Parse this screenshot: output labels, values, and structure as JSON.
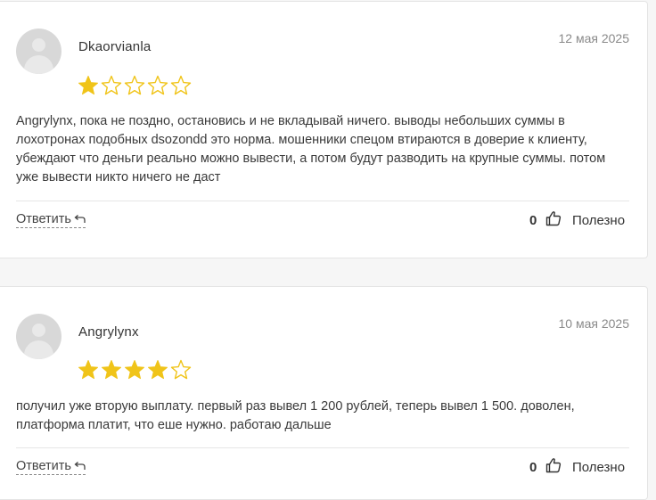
{
  "reviews": [
    {
      "author": "Dkaorvianla",
      "date": "12 мая 2025",
      "rating": 1,
      "max_rating": 5,
      "text": "Angrylynx, пока не поздно, остановись и не вкладывай ничего. выводы небольших суммы в лохотронах подобных dsozondd это норма. мошенники спецом втираются в доверие к клиенту, убеждают что деньги реально можно вывести, а потом будут разводить на крупные суммы. потом уже вывести никто ничего не даст",
      "reply_label": "Ответить",
      "vote_count": "0",
      "helpful_label": "Полезно"
    },
    {
      "author": "Angrylynx",
      "date": "10 мая 2025",
      "rating": 4,
      "max_rating": 5,
      "text": "получил уже вторую выплату. первый раз вывел 1 200 рублей, теперь вывел 1 500. доволен, платформа платит, что еше нужно. работаю дальше",
      "reply_label": "Ответить",
      "vote_count": "0",
      "helpful_label": "Полезно"
    }
  ],
  "colors": {
    "star_filled": "#f0c419",
    "star_empty_stroke": "#f0c419",
    "card_bg": "#ffffff",
    "page_bg": "#f6f6f6"
  },
  "icons": {
    "reply": "reply-arrow-icon",
    "like": "thumbs-up-icon",
    "avatar": "default-user-avatar"
  }
}
